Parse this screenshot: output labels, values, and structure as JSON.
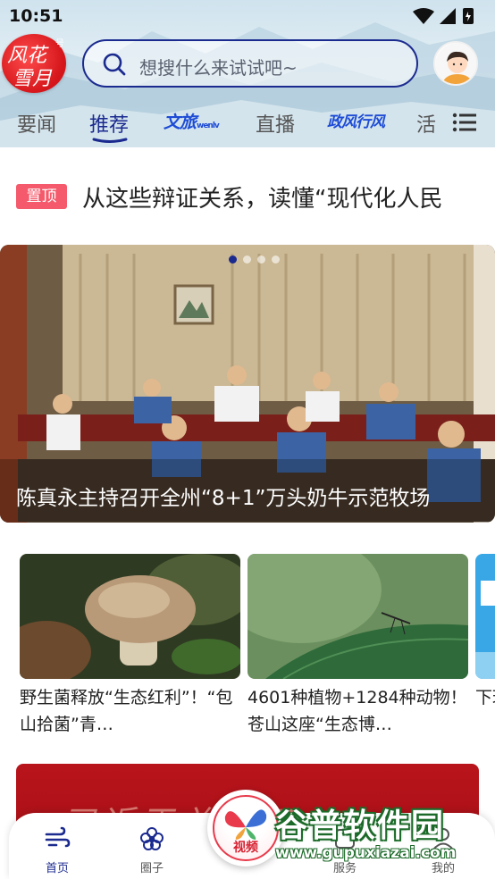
{
  "status_bar": {
    "time": "10:51"
  },
  "header": {
    "logo_line1": "风花",
    "logo_line2": "雪月",
    "logo_badge": "号",
    "search_placeholder": "想搜什么来试试吧~"
  },
  "tabs": [
    {
      "label": "要闻"
    },
    {
      "label": "推荐",
      "active": true
    },
    {
      "label": "文旅",
      "sub": "wenlv"
    },
    {
      "label": "直播"
    },
    {
      "label": "政风行风"
    },
    {
      "label": "活"
    }
  ],
  "pinned": {
    "badge": "置顶",
    "title": "从这些辩证关系，读懂“现代化人民"
  },
  "carousel": {
    "caption": "陈真永主持召开全州“8+1”万头奶牛示范牧场",
    "slide_count": 4,
    "active_slide": 1
  },
  "cards": [
    {
      "title": "野生菌释放“生态红利”！“包山拾菌”青…"
    },
    {
      "title": "4601种植物+1284种动物！苍山这座“生态博…"
    },
    {
      "title": "下理"
    }
  ],
  "banner": {
    "text": "习近平总书记"
  },
  "bottom_nav": {
    "items": [
      {
        "label": "首页",
        "icon": "wind-icon",
        "active": true
      },
      {
        "label": "圈子",
        "icon": "flower-icon"
      },
      {
        "label": "服务",
        "icon": "service-icon"
      },
      {
        "label": "我的",
        "icon": "user-icon"
      }
    ],
    "video_label": "视频"
  },
  "watermark": {
    "title": "谷普软件园",
    "url": "www.gupuxiazai.com"
  },
  "colors": {
    "brand_blue": "#1b2a8f",
    "brand_red": "#d4151a",
    "pin_red": "#f45a6b"
  }
}
